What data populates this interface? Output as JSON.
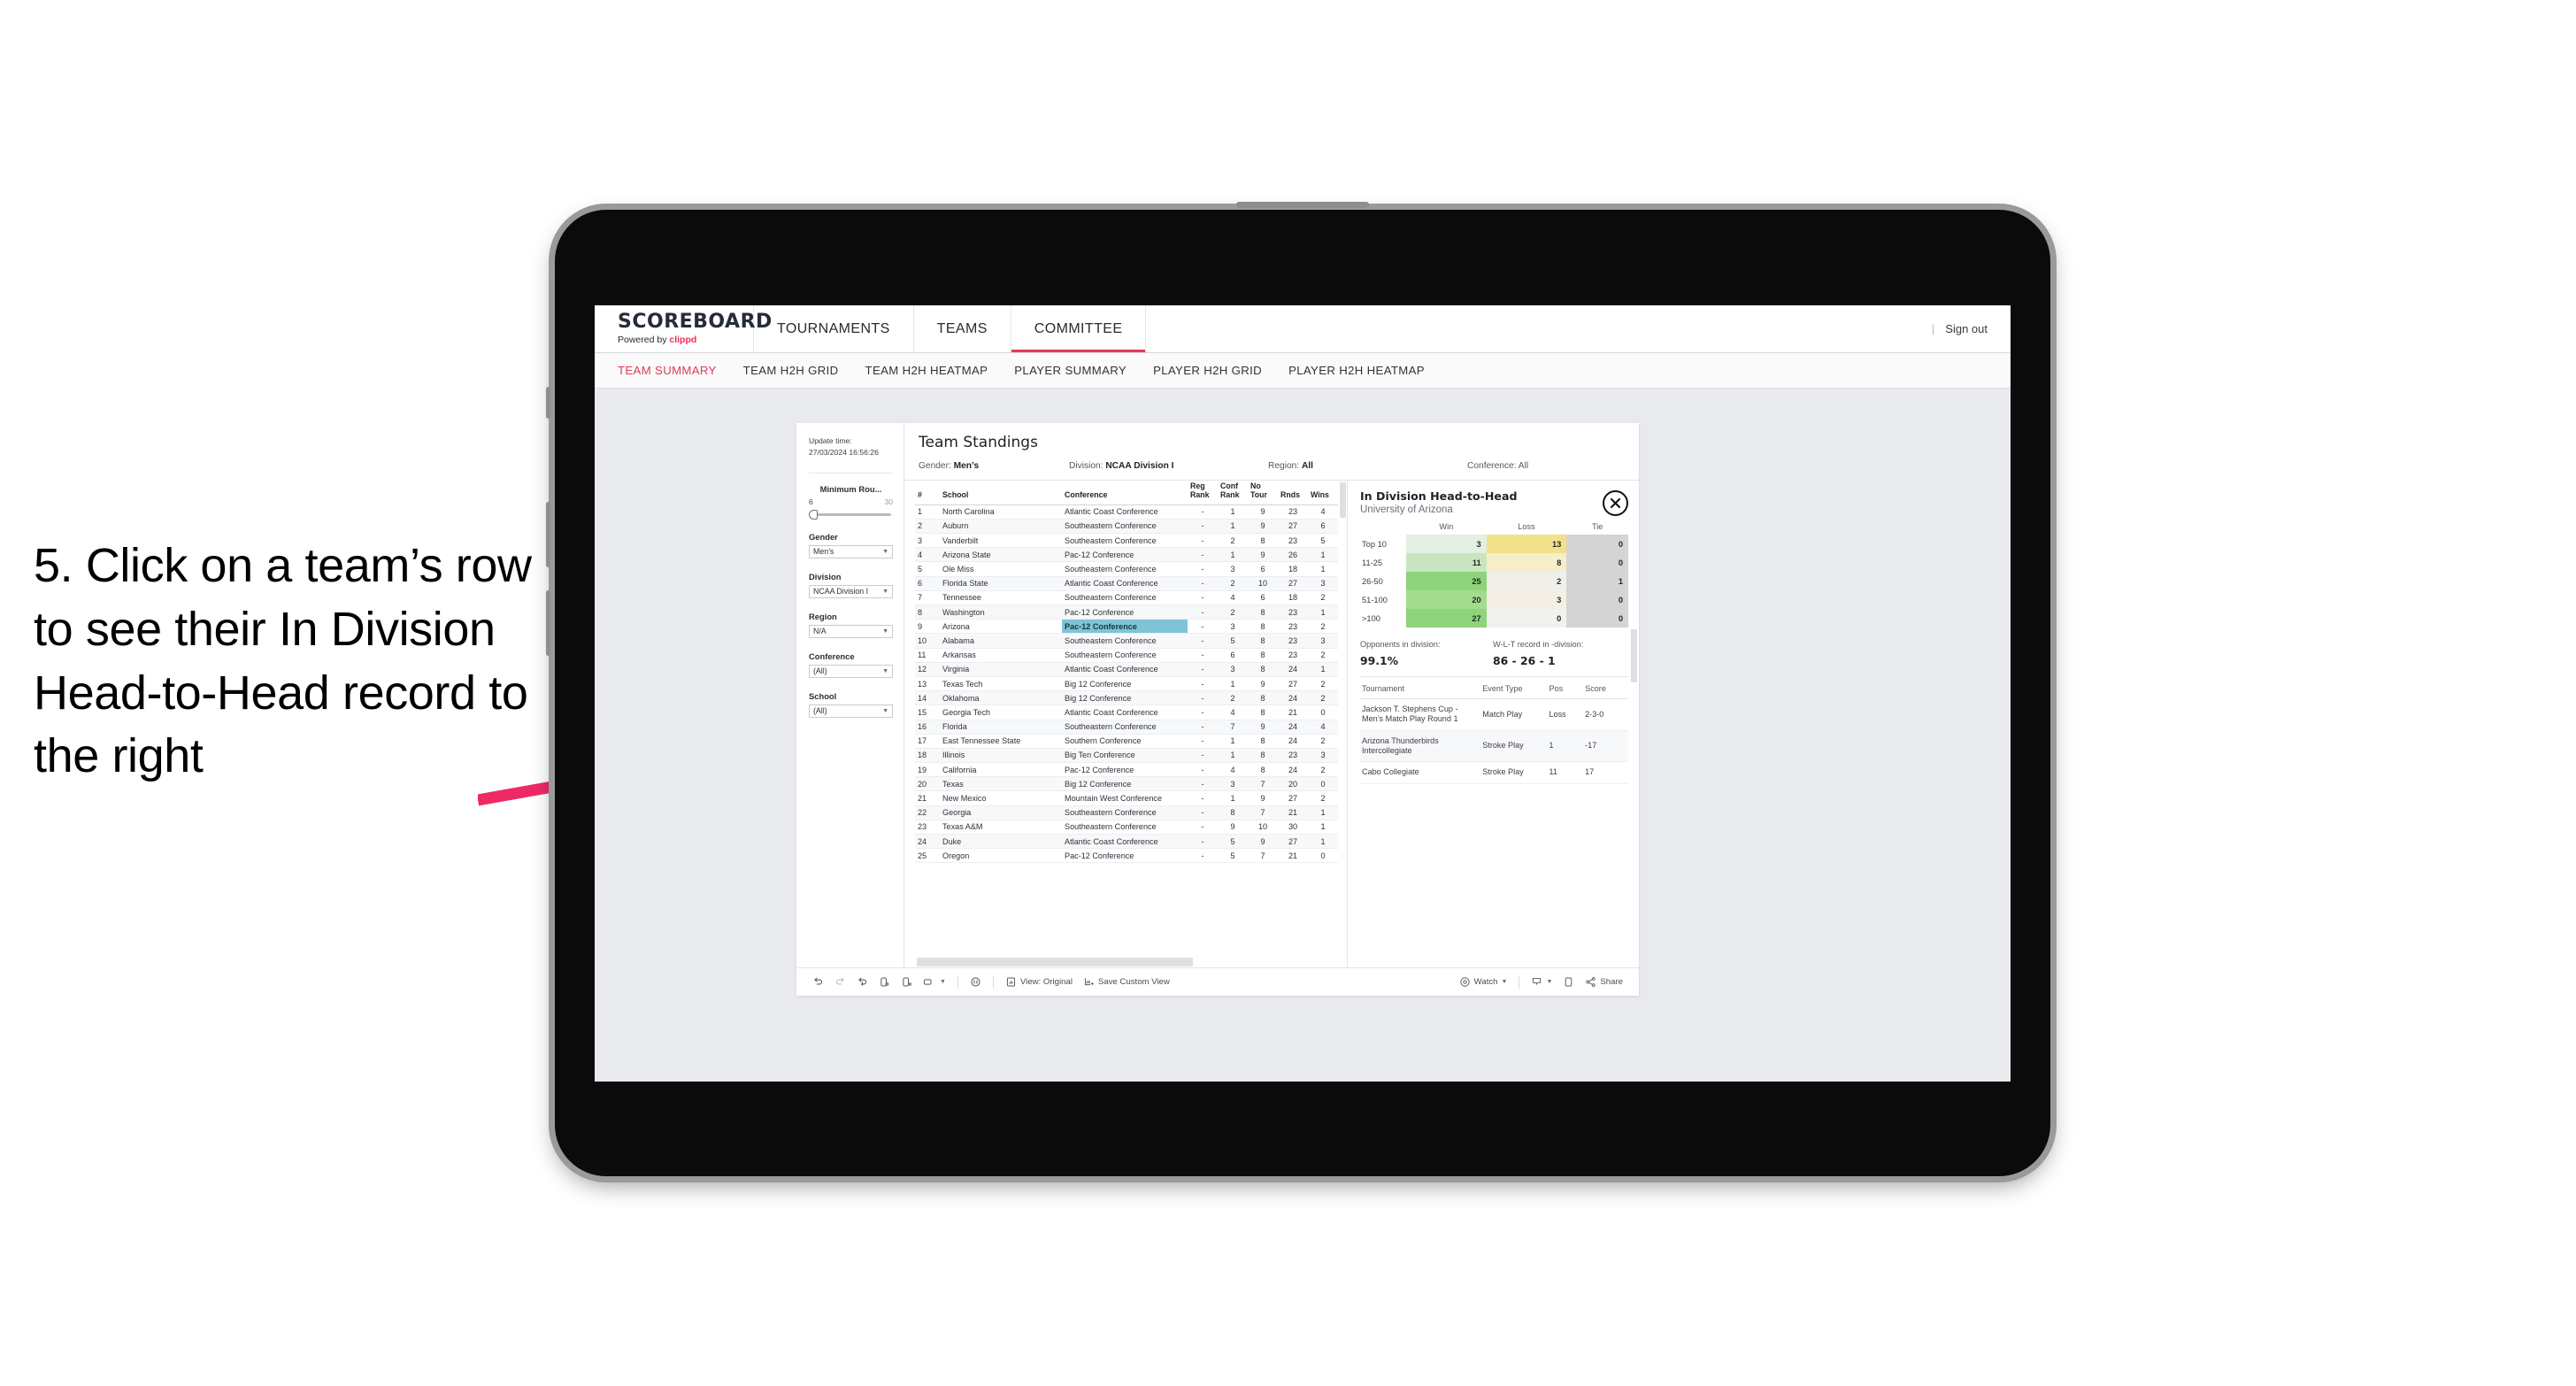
{
  "annotation": {
    "text": "5. Click on a team’s row to see their In Division Head-to-Head record to the right"
  },
  "app": {
    "logo": "SCOREBOARD",
    "logo_sub_prefix": "Powered by ",
    "logo_sub_brand": "clippd",
    "nav": [
      {
        "label": "TOURNAMENTS",
        "active": false
      },
      {
        "label": "TEAMS",
        "active": false
      },
      {
        "label": "COMMITTEE",
        "active": true
      }
    ],
    "sign_out": "Sign out",
    "divider": "|",
    "subnav": [
      {
        "label": "TEAM SUMMARY",
        "active": true
      },
      {
        "label": "TEAM H2H GRID",
        "active": false
      },
      {
        "label": "TEAM H2H HEATMAP",
        "active": false
      },
      {
        "label": "PLAYER SUMMARY",
        "active": false
      },
      {
        "label": "PLAYER H2H GRID",
        "active": false
      },
      {
        "label": "PLAYER H2H HEATMAP",
        "active": false
      }
    ],
    "accent": "#e2385a"
  },
  "rail": {
    "update_label": "Update time:",
    "update_value": "27/03/2024 16:56:26",
    "slider": {
      "label": "Minimum Rou...",
      "min": "6",
      "max": "30"
    },
    "filters": [
      {
        "label": "Gender",
        "value": "Men’s"
      },
      {
        "label": "Division",
        "value": "NCAA Division I"
      },
      {
        "label": "Region",
        "value": "N/A"
      },
      {
        "label": "Conference",
        "value": "(All)"
      },
      {
        "label": "School",
        "value": "(All)"
      }
    ]
  },
  "viz": {
    "title": "Team Standings",
    "params": [
      {
        "label": "Gender: ",
        "value": "Men’s"
      },
      {
        "label": "Division: ",
        "value": "NCAA Division I"
      },
      {
        "label": "Region: ",
        "value": "All"
      },
      {
        "label": "Conference: ",
        "value": "All"
      }
    ]
  },
  "standings": {
    "columns": [
      "#",
      "School",
      "Conference",
      "Reg Rank",
      "Conf Rank",
      "No Tour",
      "Rnds",
      "Wins"
    ],
    "rows": [
      [
        "1",
        "North Carolina",
        "Atlantic Coast Conference",
        "-",
        "1",
        "9",
        "23",
        "4"
      ],
      [
        "2",
        "Auburn",
        "Southeastern Conference",
        "-",
        "1",
        "9",
        "27",
        "6"
      ],
      [
        "3",
        "Vanderbilt",
        "Southeastern Conference",
        "-",
        "2",
        "8",
        "23",
        "5"
      ],
      [
        "4",
        "Arizona State",
        "Pac-12 Conference",
        "-",
        "1",
        "9",
        "26",
        "1"
      ],
      [
        "5",
        "Ole Miss",
        "Southeastern Conference",
        "-",
        "3",
        "6",
        "18",
        "1"
      ],
      [
        "6",
        "Florida State",
        "Atlantic Coast Conference",
        "-",
        "2",
        "10",
        "27",
        "3"
      ],
      [
        "7",
        "Tennessee",
        "Southeastern Conference",
        "-",
        "4",
        "6",
        "18",
        "2"
      ],
      [
        "8",
        "Washington",
        "Pac-12 Conference",
        "-",
        "2",
        "8",
        "23",
        "1"
      ],
      [
        "9",
        "Arizona",
        "Pac-12 Conference",
        "-",
        "3",
        "8",
        "23",
        "2"
      ],
      [
        "10",
        "Alabama",
        "Southeastern Conference",
        "-",
        "5",
        "8",
        "23",
        "3"
      ],
      [
        "11",
        "Arkansas",
        "Southeastern Conference",
        "-",
        "6",
        "8",
        "23",
        "2"
      ],
      [
        "12",
        "Virginia",
        "Atlantic Coast Conference",
        "-",
        "3",
        "8",
        "24",
        "1"
      ],
      [
        "13",
        "Texas Tech",
        "Big 12 Conference",
        "-",
        "1",
        "9",
        "27",
        "2"
      ],
      [
        "14",
        "Oklahoma",
        "Big 12 Conference",
        "-",
        "2",
        "8",
        "24",
        "2"
      ],
      [
        "15",
        "Georgia Tech",
        "Atlantic Coast Conference",
        "-",
        "4",
        "8",
        "21",
        "0"
      ],
      [
        "16",
        "Florida",
        "Southeastern Conference",
        "-",
        "7",
        "9",
        "24",
        "4"
      ],
      [
        "17",
        "East Tennessee State",
        "Southern Conference",
        "-",
        "1",
        "8",
        "24",
        "2"
      ],
      [
        "18",
        "Illinois",
        "Big Ten Conference",
        "-",
        "1",
        "8",
        "23",
        "3"
      ],
      [
        "19",
        "California",
        "Pac-12 Conference",
        "-",
        "4",
        "8",
        "24",
        "2"
      ],
      [
        "20",
        "Texas",
        "Big 12 Conference",
        "-",
        "3",
        "7",
        "20",
        "0"
      ],
      [
        "21",
        "New Mexico",
        "Mountain West Conference",
        "-",
        "1",
        "9",
        "27",
        "2"
      ],
      [
        "22",
        "Georgia",
        "Southeastern Conference",
        "-",
        "8",
        "7",
        "21",
        "1"
      ],
      [
        "23",
        "Texas A&M",
        "Southeastern Conference",
        "-",
        "9",
        "10",
        "30",
        "1"
      ],
      [
        "24",
        "Duke",
        "Atlantic Coast Conference",
        "-",
        "5",
        "9",
        "27",
        "1"
      ],
      [
        "25",
        "Oregon",
        "Pac-12 Conference",
        "-",
        "5",
        "7",
        "21",
        "0"
      ]
    ],
    "selected_row_index": 8,
    "selected_cell_column": 2,
    "selected_highlight_color": "#7fc4d6"
  },
  "detail": {
    "title": "In Division Head-to-Head",
    "subtitle": "University of Arizona",
    "close_icon": "close-icon",
    "h2h": {
      "columns": [
        "Win",
        "Loss",
        "Tie"
      ],
      "rows": [
        {
          "bucket": "Top 10",
          "win": "3",
          "loss": "13",
          "tie": "0",
          "win_color": "#e3efe0",
          "loss_color": "#f2e08a",
          "tie_color": "#d4d4d4"
        },
        {
          "bucket": "11-25",
          "win": "11",
          "loss": "8",
          "tie": "0",
          "win_color": "#c9e5bf",
          "loss_color": "#f6eec9",
          "tie_color": "#d4d4d4"
        },
        {
          "bucket": "26-50",
          "win": "25",
          "loss": "2",
          "tie": "1",
          "win_color": "#8ed47a",
          "loss_color": "#f0efe9",
          "tie_color": "#d4d4d4"
        },
        {
          "bucket": "51-100",
          "win": "20",
          "loss": "3",
          "tie": "0",
          "win_color": "#a2dc8c",
          "loss_color": "#f3efe4",
          "tie_color": "#d4d4d4"
        },
        {
          "bucket": ">100",
          "win": "27",
          "loss": "0",
          "tie": "0",
          "win_color": "#8ed47a",
          "loss_color": "#f1f1ef",
          "tie_color": "#d4d4d4"
        }
      ]
    },
    "stats": [
      {
        "label": "Opponents in division:",
        "value": "99.1%"
      },
      {
        "label": "W-L-T record in -division:",
        "value": "86 - 26 - 1"
      }
    ],
    "tournaments": {
      "columns": [
        "Tournament",
        "Event Type",
        "Pos",
        "Score"
      ],
      "rows": [
        [
          "Jackson T. Stephens Cup - Men’s Match Play Round 1",
          "Match Play",
          "Loss",
          "2-3-0"
        ],
        [
          "Arizona Thunderbirds Intercollegiate",
          "Stroke Play",
          "1",
          "-17"
        ],
        [
          "Cabo Collegiate",
          "Stroke Play",
          "11",
          "17"
        ]
      ]
    }
  },
  "toolbar": {
    "view_label": "View: Original",
    "save_label": "Save Custom View",
    "watch_label": "Watch",
    "share_label": "Share"
  }
}
